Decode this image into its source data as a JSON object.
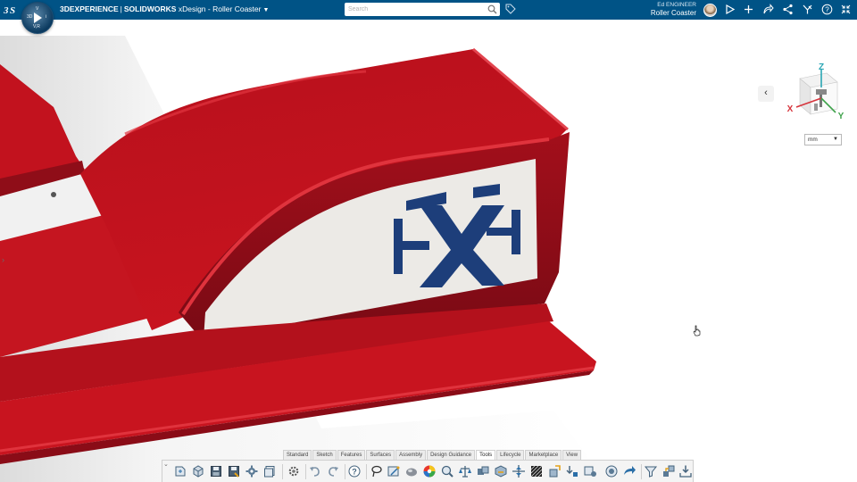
{
  "header": {
    "brand": "3DEXPERIENCE",
    "product": "SOLIDWORKS",
    "app": "xDesign",
    "model": "Roller Coaster",
    "title_sep": "-",
    "search_placeholder": "Search",
    "user_name": "Ed ENGINEER",
    "user_model": "Roller Coaster",
    "compass_quadrant_labels": [
      "3D",
      "V",
      "V,R",
      "i"
    ],
    "icons": [
      "3ds-logo",
      "compass-icon",
      "search-icon",
      "tag-icon",
      "avatar",
      "play-icon",
      "plus-icon",
      "share-icon",
      "network-icon",
      "apps-icon",
      "help-icon",
      "collapse-icon"
    ]
  },
  "viewport": {
    "left_expand_glyph": "›",
    "back_glyph": "‹",
    "units_value": "mm",
    "triad_labels": {
      "z": "Z",
      "x": "X",
      "y": "Y"
    },
    "model_colors": {
      "body": "#c9141f",
      "body_dark": "#8f0d18",
      "panel": "#eceae6",
      "logo": "#1d3e7a"
    }
  },
  "action_bar": {
    "tabs": [
      "Standard",
      "Sketch",
      "Features",
      "Surfaces",
      "Assembly",
      "Design Guidance",
      "Tools",
      "Lifecycle",
      "Marketplace",
      "View"
    ],
    "active_tab": "Tools",
    "tools": [
      "new-icon",
      "open-icon",
      "save-icon",
      "save-as-icon",
      "settings-icon",
      "copy-icon",
      "gear-icon",
      "undo-icon",
      "redo-icon",
      "help-icon",
      "lasso-icon",
      "measure-icon",
      "appearance-icon",
      "color-icon",
      "zoom-icon",
      "balance-icon",
      "assembly-icon",
      "section-icon",
      "pattern-icon",
      "fill-icon",
      "move-icon",
      "insert-icon",
      "component-icon",
      "photo-icon",
      "arrow-icon",
      "filter-icon",
      "connect-icon",
      "download-icon"
    ]
  }
}
